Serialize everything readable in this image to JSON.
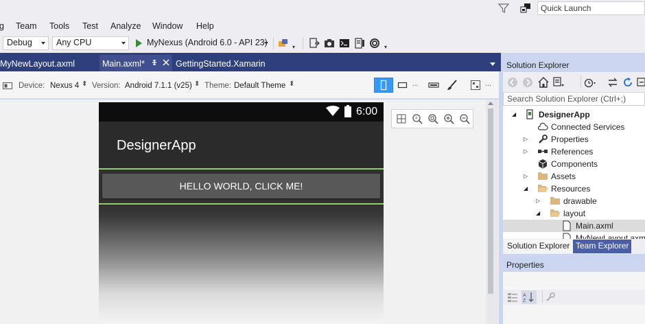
{
  "title_bar": {
    "quick_launch_placeholder": "Quick Launch"
  },
  "menu": {
    "items": [
      "g",
      "Team",
      "Tools",
      "Test",
      "Analyze",
      "Window",
      "Help"
    ]
  },
  "toolbar": {
    "config": "Debug",
    "platform": "Any CPU",
    "run_target": "MyNexus (Android 6.0 - API 23)"
  },
  "doc_tabs": {
    "tabs": [
      {
        "label": "MyNewLayout.axml"
      },
      {
        "label": "Main.axml*"
      },
      {
        "label": "GettingStarted.Xamarin"
      }
    ]
  },
  "designer_toolbar": {
    "device_label": "Device:",
    "device_value": "Nexus 4",
    "version_label": "Version:",
    "version_value": "Android 7.1.1 (v25)",
    "theme_label": "Theme:",
    "theme_value": "Default Theme",
    "more": "..."
  },
  "phone": {
    "status_time": "6:00",
    "app_title": "DesignerApp",
    "button_text": "HELLO WORLD, CLICK ME!"
  },
  "solution_explorer": {
    "title": "Solution Explorer",
    "search_placeholder": "Search Solution Explorer (Ctrl+;)",
    "tree": [
      {
        "label": "DesignerApp"
      },
      {
        "label": "Connected Services"
      },
      {
        "label": "Properties"
      },
      {
        "label": "References"
      },
      {
        "label": "Components"
      },
      {
        "label": "Assets"
      },
      {
        "label": "Resources"
      },
      {
        "label": "drawable"
      },
      {
        "label": "layout"
      },
      {
        "label": "Main.axml"
      },
      {
        "label": "MyNewLayout.axml"
      }
    ],
    "tabs": [
      "Solution Explorer",
      "Team Explorer"
    ]
  },
  "properties": {
    "title": "Properties"
  },
  "colors": {
    "accent": "#3399ff",
    "tab_bar": "#2d3f7d",
    "selection_outline": "#8fd166",
    "run_green": "#388a34"
  }
}
